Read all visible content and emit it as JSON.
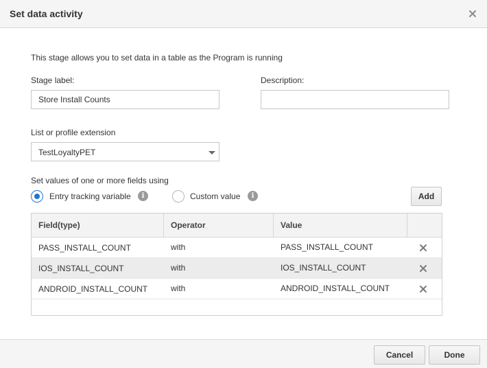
{
  "dialog": {
    "title": "Set data activity",
    "intro": "This stage allows you to set data in a table as the Program is running"
  },
  "form": {
    "stage_label": {
      "label": "Stage label:",
      "value": "Store Install Counts"
    },
    "description": {
      "label": "Description:",
      "value": ""
    },
    "extension": {
      "label": "List or profile extension",
      "value": "TestLoyaltyPET"
    },
    "set_values": {
      "label": "Set values of one or more fields using",
      "options": [
        {
          "label": "Entry tracking variable",
          "checked": true
        },
        {
          "label": "Custom value",
          "checked": false
        }
      ],
      "add_label": "Add"
    }
  },
  "table": {
    "columns": [
      "Field(type)",
      "Operator",
      "Value",
      ""
    ],
    "rows": [
      {
        "field": "PASS_INSTALL_COUNT",
        "operator": "with",
        "value": "PASS_INSTALL_COUNT"
      },
      {
        "field": "IOS_INSTALL_COUNT",
        "operator": "with",
        "value": "IOS_INSTALL_COUNT"
      },
      {
        "field": "ANDROID_INSTALL_COUNT",
        "operator": "with",
        "value": "ANDROID_INSTALL_COUNT"
      }
    ]
  },
  "footer": {
    "cancel_label": "Cancel",
    "done_label": "Done"
  },
  "colors": {
    "accent": "#1f77d0",
    "header_bg": "#f5f5f5",
    "row_alt_bg": "#ececec"
  },
  "icons": {
    "close": "close-icon",
    "info": "info-icon",
    "delete": "remove-row-icon",
    "dropdown": "chevron-down-icon"
  }
}
